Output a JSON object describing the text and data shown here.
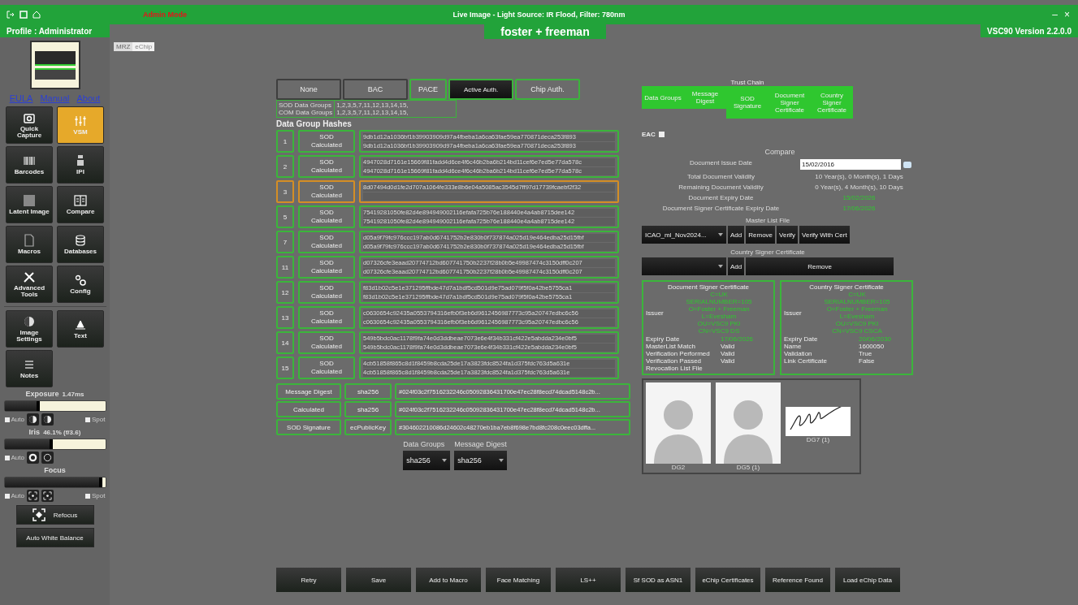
{
  "header": {
    "admin_mode": "Admin Mode",
    "profile": "Profile : Administrator",
    "live_image": "Live Image - Light Source: IR Flood, Filter: 780nm",
    "brand": "foster + freeman",
    "version": "VSC90 Version 2.2.0.0",
    "window_controls": [
      "–",
      "×"
    ]
  },
  "view_tabs": [
    {
      "label": "MRZ",
      "selected": false
    },
    {
      "label": "eChip",
      "selected": true
    }
  ],
  "sidebar": {
    "links": [
      "EULA",
      "Manual",
      "About"
    ],
    "tools": [
      {
        "label": "Quick Capture",
        "selected": false
      },
      {
        "label": "VSM",
        "selected": true
      },
      {
        "label": "Barcodes",
        "selected": false
      },
      {
        "label": "IPI",
        "selected": false
      },
      {
        "label": "Latent Image",
        "selected": false
      },
      {
        "label": "Compare",
        "selected": false
      },
      {
        "label": "Macros",
        "selected": false
      },
      {
        "label": "Databases",
        "selected": false
      },
      {
        "label": "Advanced Tools",
        "selected": false
      },
      {
        "label": "Config",
        "selected": false
      }
    ],
    "extra_tools": [
      {
        "label": "Image Settings",
        "selected": false
      },
      {
        "label": "Text",
        "selected": false
      },
      {
        "label": "Notes",
        "selected": false
      }
    ],
    "controls": [
      {
        "title": "Exposure",
        "reading": "1.47ms",
        "level": 0.35,
        "auto": {
          "label": "Auto",
          "checked": false
        },
        "spot": {
          "label": "Spot",
          "checked": false
        }
      },
      {
        "title": "Iris",
        "reading": "46.1% (f/3.6)",
        "level": 0.48,
        "auto": {
          "label": "Auto",
          "checked": false
        }
      },
      {
        "title": "Focus",
        "level": 0.97,
        "auto": {
          "label": "Auto",
          "checked": false
        },
        "spot": {
          "label": "Spot",
          "checked": false
        }
      }
    ],
    "refocus": "Refocus",
    "white_balance": "Auto White Balance"
  },
  "auth_tabs": [
    {
      "label": "None",
      "passed": false,
      "selected": false
    },
    {
      "label": "BAC",
      "passed": false,
      "selected": false
    },
    {
      "label": "PACE",
      "passed": true,
      "selected": false
    },
    {
      "label": "Active Auth.",
      "passed": true,
      "selected": true
    },
    {
      "label": "Chip Auth.",
      "passed": true,
      "selected": false
    }
  ],
  "group_lists": [
    {
      "label": "SOD Data Groups",
      "value": "1,2,3,5,7,11,12,13,14,15,"
    },
    {
      "label": "COM Data Groups",
      "value": "1,2,3,5,7,11,12,13,14,15,"
    }
  ],
  "hashes_title": "Data Group Hashes",
  "hashes": [
    {
      "group": "1",
      "matched": true,
      "sod_label": "SOD",
      "calc_label": "Calculated",
      "sod": "9db1d12a1036bf1b39903909d97a4fbeba1a6ca63fae59ea770871deca253f893",
      "calculated": "9db1d12a1036bf1b39903909d97a4fbeba1a6ca63fae59ea770871deca253f893"
    },
    {
      "group": "2",
      "matched": true,
      "sod_label": "SOD",
      "calc_label": "Calculated",
      "sod": "4947028d7161e15669f81fadd4d6ce4f6c46b2ba6b214bd11cef6e7ed5e77da578c",
      "calculated": "4947028d7161e15669f81fadd4d6ce4f6c46b2ba6b214bd11cef6e7ed5e77da578c"
    },
    {
      "group": "3",
      "matched": false,
      "sod_label": "SOD",
      "calc_label": "Calculated",
      "sod": "8d07494d0d1fe2d707a1064fe333e8b6e04a5085ac3545d7ff97d17739fcaebf2f32"
    },
    {
      "group": "5",
      "matched": true,
      "sod_label": "SOD",
      "calc_label": "Calculated",
      "sod": "75419281050fe82d4e894949002116efafa725b76e188440e4a4ab8715dee142",
      "calculated": "75419281050fe82d4e894949002116efafa725b76e188440e4a4ab8715dee142"
    },
    {
      "group": "7",
      "matched": true,
      "sod_label": "SOD",
      "calc_label": "Calculated",
      "sod": "d05a9f79fc976ccc197ab0d6741752b2e830b0f737874a025d19e464edba25d15fbf",
      "calculated": "d05a9f79fc976ccc197ab0d6741752b2e830b0f737874a025d19e464edba25d15fbf"
    },
    {
      "group": "11",
      "matched": true,
      "sod_label": "SOD",
      "calc_label": "Calculated",
      "sod": "d07326cfe3eaad20774712bd607741750b2237f28b0b5e49987474c3150dff0c207",
      "calculated": "d07326cfe3eaad20774712bd607741750b2237f28b0b5e49987474c3150dff0c207"
    },
    {
      "group": "12",
      "matched": true,
      "sod_label": "SOD",
      "calc_label": "Calculated",
      "sod": "f83d1b02c5e1e371295ffbde47d7a1bdf5cd501d9e75ad079f5f0a42be5755ca1",
      "calculated": "f83d1b02c5e1e371295ffbde47d7a1bdf5cd501d9e75ad079f5f0a42be5755ca1"
    },
    {
      "group": "13",
      "matched": true,
      "sod_label": "SOD",
      "calc_label": "Calculated",
      "sod": "c0630654c92435a0553794316efb0f3eb6d9612456987773c95a20747edbc6c56",
      "calculated": "c0630654c92435a0553794316efb0f3eb6d9612456987773c95a20747edbc6c56"
    },
    {
      "group": "14",
      "matched": true,
      "sod_label": "SOD",
      "calc_label": "Calculated",
      "sod": "549b5bdc0ac1178f9fa74e0d3ddbeae7073e6e4f34b331cf422e5abdda234e0bf5",
      "calculated": "549b5bdc0ac1178f9fa74e0d3ddbeae7073e6e4f34b331cf422e5abdda234e0bf5"
    },
    {
      "group": "15",
      "matched": true,
      "sod_label": "SOD",
      "calc_label": "Calculated",
      "sod": "4cb51858f865c8d1f8459b8cda25de17a3823fdc8524fa1d375fdc763d5a631e",
      "calculated": "4cb51858f865c8d1f8459b8cda25de17a3823fdc8524fa1d375fdc763d5a631e"
    }
  ],
  "digests": [
    {
      "label": "Message Digest",
      "algorithm": "sha256",
      "value": "#024f03c2f7516232246c05092836431700e47ec28f8ecd74dcad5148c2b..."
    },
    {
      "label": "Calculated",
      "algorithm": "sha256",
      "value": "#024f03c2f7516232246c05092836431700e47ec28f8ecd74dcad5148c2b..."
    },
    {
      "label": "SOD Signature",
      "algorithm": "ecPublicKey",
      "value": "#304602210086d24602c48270eb1ba7eb8f698e7bd8fc208c0eec03dffa..."
    }
  ],
  "algorithm_selectors": [
    {
      "label": "Data Groups",
      "value": "sha256"
    },
    {
      "label": "Message Digest",
      "value": "sha256"
    }
  ],
  "trust_chain": {
    "title": "Trust Chain",
    "items": [
      {
        "label": "Data Groups",
        "passed": true
      },
      {
        "label": "Message Digest",
        "passed": true
      },
      {
        "label": "SOD Signature",
        "passed": true
      },
      {
        "label": "Document Signer Certificate",
        "passed": true
      },
      {
        "label": "Country Signer Certificate",
        "passed": true
      }
    ]
  },
  "eac": {
    "label": "EAC",
    "checked": false
  },
  "compare": {
    "title": "Compare",
    "rows": [
      {
        "label": "Document Issue Date",
        "value": "15/02/2016",
        "kind": "date_input"
      },
      {
        "label": "Total Document Validity",
        "value": "10 Year(s), 0 Month(s), 1 Days",
        "kind": "text"
      },
      {
        "label": "Remaining Document Validity",
        "value": "0 Year(s), 4 Month(s), 10 Days",
        "kind": "text"
      },
      {
        "label": "Document Expiry Date",
        "value": "15/02/2026",
        "kind": "valid"
      },
      {
        "label": "Document Signer Certificate Expiry Date",
        "value": "17/06/2026",
        "kind": "valid"
      }
    ]
  },
  "master_list": {
    "title": "Master List File",
    "file": "ICAO_ml_Nov2024...",
    "buttons": [
      "Add",
      "Remove",
      "Verify",
      "Verify With Cert"
    ]
  },
  "country_signer": {
    "title": "Country Signer Certificate",
    "buttons": [
      "Add",
      "Remove"
    ]
  },
  "certificates": [
    {
      "title": "Document Signer Certificate",
      "issuer_label": "Issuer",
      "issuer": [
        "C=UK",
        "SERIALNUMBER=105",
        "O=Foster + Freeman",
        "L=Evesham",
        "OU=VSC9 PKI",
        "CN=VSC9 DS"
      ],
      "fields": [
        {
          "label": "Expiry Date",
          "value": "17/06/2026",
          "kind": "valid"
        },
        {
          "label": "MasterList Match",
          "value": "Valid",
          "kind": "text"
        },
        {
          "label": "Verification Performed",
          "value": "Valid",
          "kind": "text"
        },
        {
          "label": "Verification Passed",
          "value": "Valid",
          "kind": "text"
        },
        {
          "label": "Revocation List File"
        }
      ]
    },
    {
      "title": "Country Signer Certificate",
      "issuer_label": "Issuer",
      "issuer": [
        "C=UK",
        "SERIALNUMBER=105",
        "O=Foster + Freeman",
        "L=Evesham",
        "OU=VSC9 PKI",
        "CN=VSC9 CSCA"
      ],
      "fields": [
        {
          "label": "Expiry Date",
          "value": "20/06/2030",
          "kind": "valid"
        },
        {
          "label": "Name",
          "value": "1600050",
          "kind": "text"
        },
        {
          "label": "Validation",
          "value": "True",
          "kind": "text"
        },
        {
          "label": "Link Certificate",
          "value": "False",
          "kind": "text"
        }
      ]
    }
  ],
  "images": [
    {
      "caption": "DG2",
      "kind": "photo"
    },
    {
      "caption": "DG5 (1)",
      "kind": "photo"
    },
    {
      "caption": "DG7 (1)",
      "kind": "signature"
    }
  ],
  "actions": [
    "Retry",
    "Save",
    "Add to Macro",
    "Face Matching",
    "LS++",
    "Sf SOD as ASN1",
    "eChip Certificates",
    "Reference Found",
    "Load eChip Data"
  ]
}
